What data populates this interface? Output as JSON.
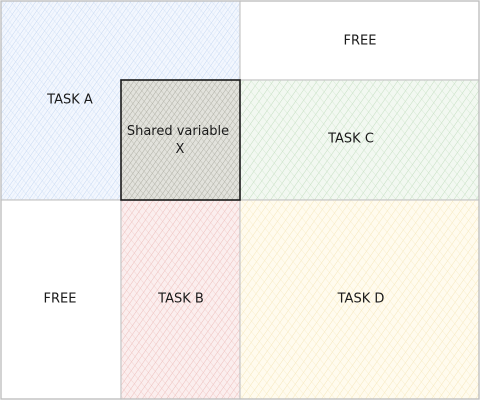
{
  "regions": {
    "task_a": {
      "label": "TASK A",
      "fill": "#dae8fc",
      "stroke": "#cfcfcf"
    },
    "free_top": {
      "label": "FREE",
      "fill": "#ffffff",
      "stroke": "#cfcfcf"
    },
    "shared": {
      "label_line1": "Shared variable",
      "label_line2": "X",
      "fill": "#b3b3a8",
      "stroke": "#1a1a1a"
    },
    "task_c": {
      "label": "TASK C",
      "fill": "#d5e8d4",
      "stroke": "#cfcfcf"
    },
    "free_bottom": {
      "label": "FREE",
      "fill": "#ffffff",
      "stroke": "#cfcfcf"
    },
    "task_b": {
      "label": "TASK B",
      "fill": "#f8cecc",
      "stroke": "#cfcfcf"
    },
    "task_d": {
      "label": "TASK D",
      "fill": "#fff2cc",
      "stroke": "#cfcfcf"
    }
  }
}
